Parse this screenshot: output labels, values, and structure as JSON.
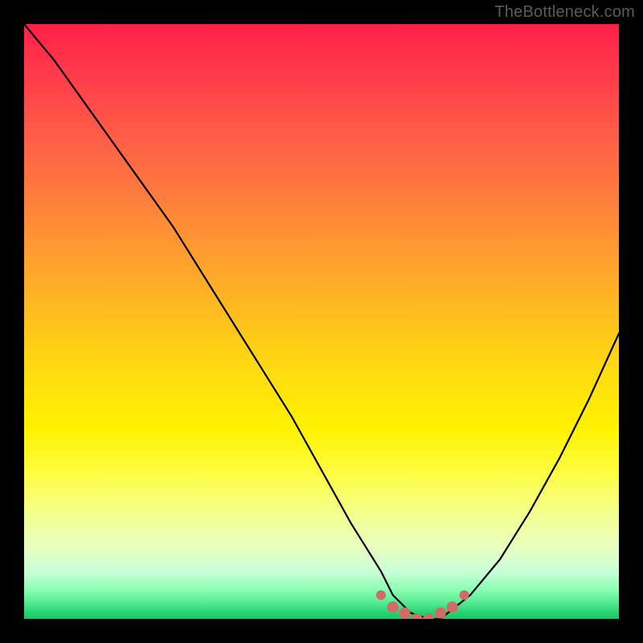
{
  "watermark": "TheBottleneck.com",
  "colors": {
    "page_bg": "#000000",
    "curve_stroke": "#000000",
    "marker_fill": "#d36a6a",
    "gradient_stops": [
      "#ff1f4a",
      "#ff3a4a",
      "#ff5a48",
      "#ff7a3e",
      "#ff9b30",
      "#ffbb20",
      "#ffda10",
      "#fff200",
      "#fdfd46",
      "#f4ff8c",
      "#e8ffc0",
      "#c8ffd6",
      "#8cffb4",
      "#4fe88f",
      "#23d36f",
      "#18c964"
    ]
  },
  "chart_data": {
    "type": "line",
    "title": "",
    "xlabel": "",
    "ylabel": "",
    "xlim": [
      0,
      100
    ],
    "ylim": [
      0,
      100
    ],
    "grid": false,
    "legend": false,
    "series": [
      {
        "name": "bottleneck-curve",
        "x": [
          0,
          5,
          10,
          15,
          20,
          25,
          30,
          35,
          40,
          45,
          50,
          55,
          60,
          62,
          65,
          68,
          70,
          75,
          80,
          85,
          90,
          95,
          100
        ],
        "values": [
          100,
          94,
          87,
          80,
          73,
          66,
          58,
          50,
          42,
          34,
          25,
          16,
          8,
          4,
          1,
          0,
          0,
          4,
          10,
          18,
          27,
          37,
          48
        ]
      }
    ],
    "markers": {
      "name": "highlight-region",
      "x": [
        60,
        62,
        64,
        66,
        68,
        70,
        72,
        74
      ],
      "values": [
        4,
        2,
        1,
        0,
        0,
        1,
        2,
        4
      ]
    }
  }
}
